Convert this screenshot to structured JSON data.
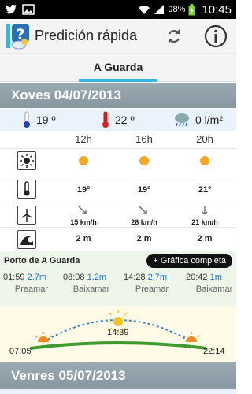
{
  "status": {
    "battery": "98%",
    "time": "10:45"
  },
  "app": {
    "title": "Predición rápida"
  },
  "tabs": [
    {
      "label": "A Guarda",
      "active": true
    }
  ],
  "days": [
    {
      "header": "Xoves 04/07/2013",
      "summary": {
        "min_temp": "19 º",
        "max_temp": "22 º",
        "rain": "0 l/m²"
      },
      "hours": [
        "12h",
        "16h",
        "20h"
      ],
      "temperature": [
        "19º",
        "19º",
        "21º"
      ],
      "wind": [
        "15 km/h",
        "28 km/h",
        "21 km/h"
      ],
      "waves": [
        "2 m",
        "2 m",
        "2 m"
      ]
    },
    {
      "header": "Venres 05/07/2013"
    }
  ],
  "tides": {
    "port": "Porto de A Guarda",
    "button": "+ Gráfica completa",
    "entries": [
      {
        "time": "01:59",
        "height": "2.7m",
        "label": "Preamar"
      },
      {
        "time": "08:08",
        "height": "1.2m",
        "label": "Baixamar"
      },
      {
        "time": "14:28",
        "height": "2.7m",
        "label": "Preamar"
      },
      {
        "time": "20:42",
        "height": "1m",
        "label": "Baixamar"
      }
    ]
  },
  "sun": {
    "sunrise": "07:05",
    "noon": "14:39",
    "sunset": "22:14"
  },
  "colors": {
    "accent": "#33b5e5",
    "header": "#8f9fa8",
    "sun": "#f5a623",
    "tide": "#1976d2"
  }
}
